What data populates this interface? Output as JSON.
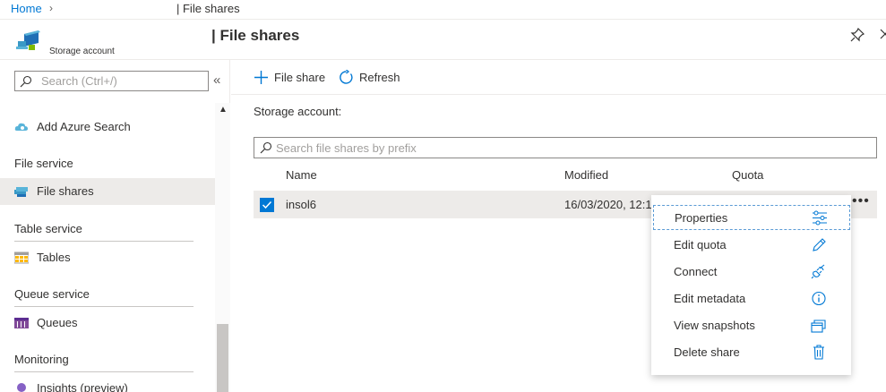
{
  "breadcrumb": {
    "home": "Home",
    "current": "| File shares"
  },
  "header": {
    "title": "| File shares",
    "resource_type": "Storage account"
  },
  "sidebar": {
    "search_placeholder": "Search (Ctrl+/)",
    "items": [
      {
        "label": "Add Azure Search",
        "icon": "cloud-search-icon"
      },
      {
        "section": "File service"
      },
      {
        "label": "File shares",
        "icon": "file-shares-icon",
        "active": true
      },
      {
        "section": "Table service"
      },
      {
        "label": "Tables",
        "icon": "table-icon"
      },
      {
        "section": "Queue service"
      },
      {
        "label": "Queues",
        "icon": "queue-icon"
      },
      {
        "section": "Monitoring"
      },
      {
        "label": "Insights (preview)",
        "icon": "insights-icon"
      }
    ]
  },
  "toolbar": {
    "add_label": "File share",
    "refresh_label": "Refresh"
  },
  "main": {
    "storage_account_label": "Storage account:",
    "search_placeholder": "Search file shares by prefix",
    "columns": [
      "Name",
      "Modified",
      "Quota"
    ],
    "rows": [
      {
        "name": "insol6",
        "modified": "16/03/2020, 12:1",
        "selected": true
      }
    ]
  },
  "context_menu": {
    "items": [
      {
        "label": "Properties",
        "icon": "settings-sliders-icon"
      },
      {
        "label": "Edit quota",
        "icon": "pencil-icon"
      },
      {
        "label": "Connect",
        "icon": "plug-icon"
      },
      {
        "label": "Edit metadata",
        "icon": "info-icon"
      },
      {
        "label": "View snapshots",
        "icon": "snapshots-icon"
      },
      {
        "label": "Delete share",
        "icon": "trash-icon"
      }
    ]
  },
  "colors": {
    "accent": "#0078d4",
    "selected_row": "#edebe9"
  }
}
